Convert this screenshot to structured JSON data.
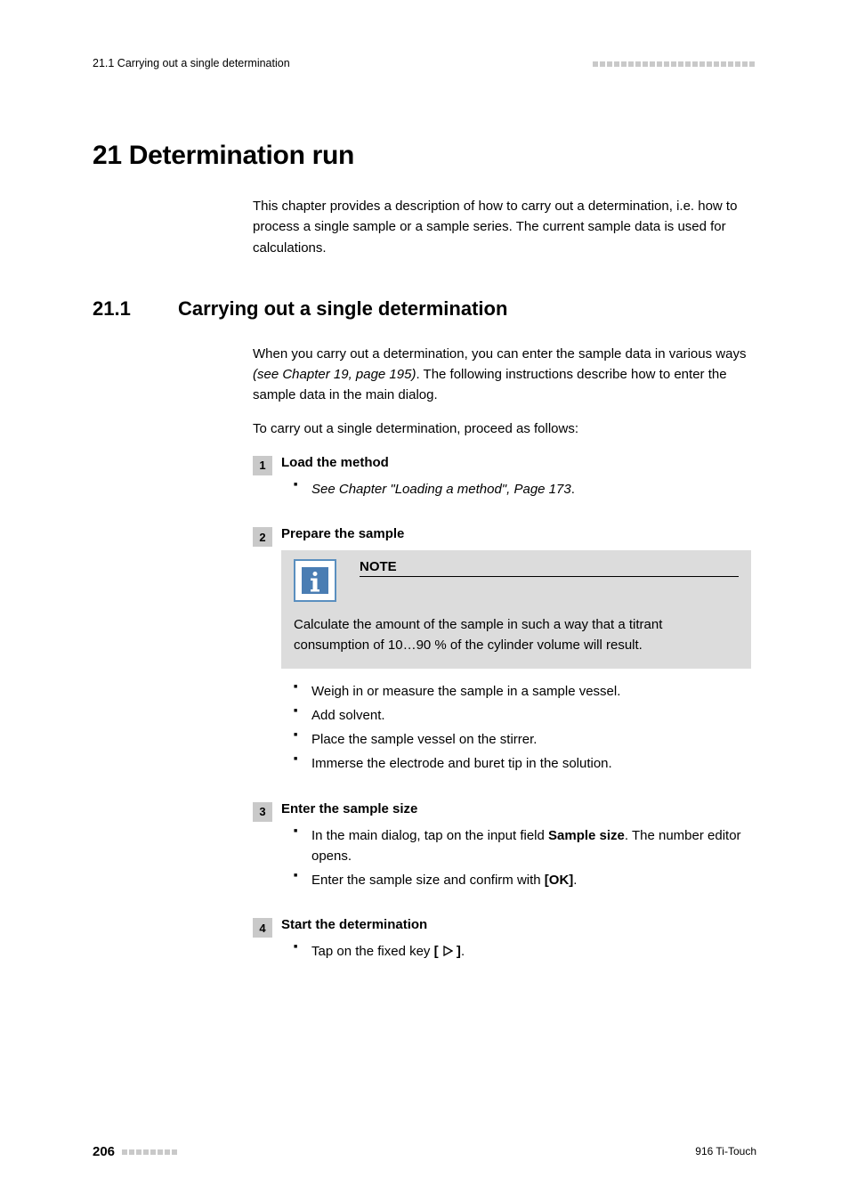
{
  "runhead": {
    "left": "21.1 Carrying out a single determination"
  },
  "chapter": {
    "title": "21 Determination run",
    "intro": "This chapter provides a description of how to carry out a determination, i.e. how to process a single sample or a sample series. The current sample data is used for calculations."
  },
  "section": {
    "number": "21.1",
    "title": "Carrying out a single determination",
    "para1_a": "When you carry out a determination, you can enter the sample data in various ways ",
    "para1_ital": "(see Chapter 19, page 195)",
    "para1_b": ". The following instructions describe how to enter the sample data in the main dialog.",
    "para2": "To carry out a single determination, proceed as follows:"
  },
  "steps": {
    "1": {
      "num": "1",
      "title": "Load the method",
      "bullets": [
        {
          "ital": "See Chapter \"Loading a method\", Page 173",
          "suffix": "."
        }
      ]
    },
    "2": {
      "num": "2",
      "title": "Prepare the sample",
      "note": {
        "label": "NOTE",
        "text": "Calculate the amount of the sample in such a way that a titrant consumption of 10…90 % of the cylinder volume will result."
      },
      "bullets": [
        "Weigh in or measure the sample in a sample vessel.",
        "Add solvent.",
        "Place the sample vessel on the stirrer.",
        "Immerse the electrode and buret tip in the solution."
      ]
    },
    "3": {
      "num": "3",
      "title": "Enter the sample size",
      "bullets_rich": {
        "b0_a": "In the main dialog, tap on the input field ",
        "b0_bold": "Sample size",
        "b0_b": ". The number editor opens.",
        "b1_a": "Enter the sample size and confirm with ",
        "b1_bold": "[OK]",
        "b1_b": "."
      }
    },
    "4": {
      "num": "4",
      "title": "Start the determination",
      "bullets_rich": {
        "b0_a": "Tap on the fixed key ",
        "b0_bold_open": "[ ",
        "b0_bold_close": " ]",
        "b0_b": "."
      }
    }
  },
  "footer": {
    "page": "206",
    "doc": "916 Ti-Touch"
  }
}
